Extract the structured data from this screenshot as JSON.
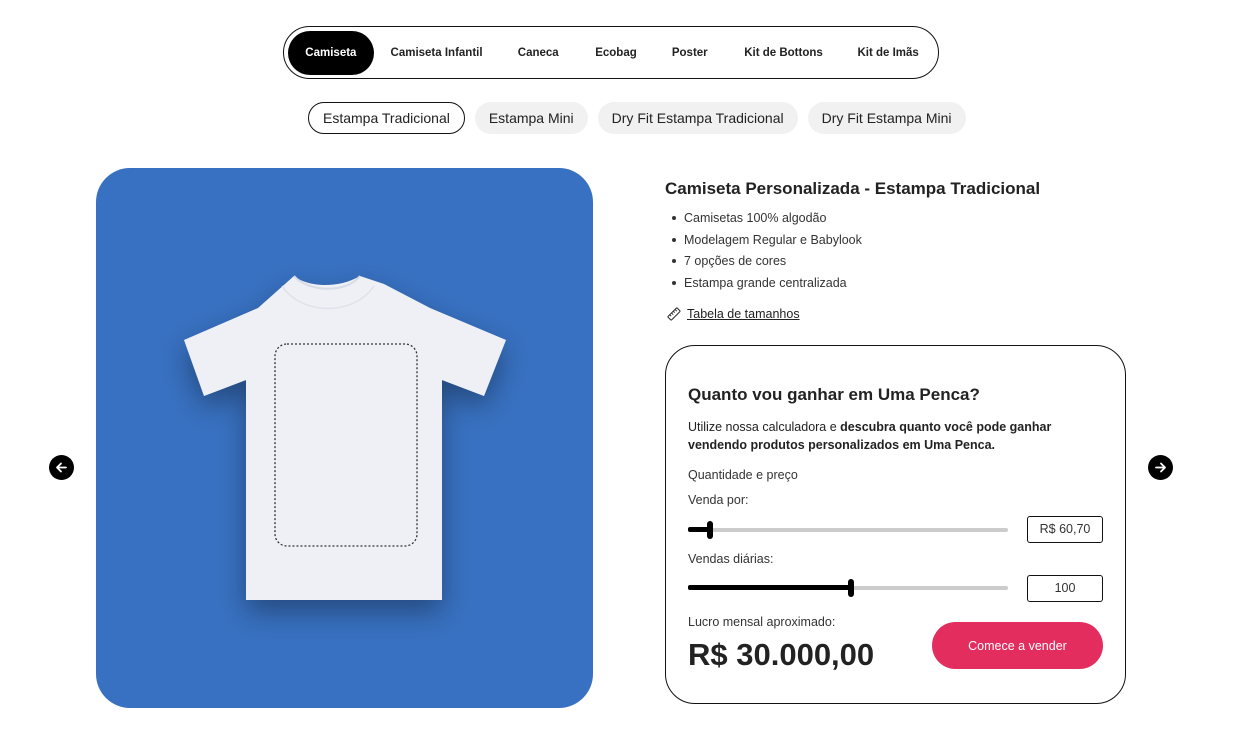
{
  "categories": {
    "items": [
      {
        "label": "Camiseta",
        "active": true
      },
      {
        "label": "Camiseta Infantil",
        "active": false
      },
      {
        "label": "Caneca",
        "active": false
      },
      {
        "label": "Ecobag",
        "active": false
      },
      {
        "label": "Poster",
        "active": false
      },
      {
        "label": "Kit de Bottons",
        "active": false
      },
      {
        "label": "Kit de Imãs",
        "active": false
      }
    ]
  },
  "subcategories": {
    "items": [
      {
        "label": "Estampa Tradicional",
        "active": true
      },
      {
        "label": "Estampa Mini",
        "active": false
      },
      {
        "label": "Dry Fit Estampa Tradicional",
        "active": false
      },
      {
        "label": "Dry Fit Estampa Mini",
        "active": false
      }
    ]
  },
  "product": {
    "title": "Camiseta Personalizada - Estampa Tradicional",
    "features": [
      "Camisetas 100% algodão",
      "Modelagem Regular e Babylook",
      "7 opções de cores",
      "Estampa grande centralizada"
    ],
    "size_chart_link": "Tabela de tamanhos",
    "image_background": "#3871c1"
  },
  "carousel": {
    "prev_icon": "arrow-left-icon",
    "next_icon": "arrow-right-icon"
  },
  "calculator": {
    "title": "Quanto vou ganhar em Uma Penca?",
    "desc_prefix": "Utilize nossa calculadora e ",
    "desc_bold": "descubra quanto você pode ganhar vendendo produtos personalizados em Uma Penca.",
    "section_label": "Quantidade e preço",
    "price_label": "Venda por:",
    "price_value": "R$ 60,70",
    "price_slider_fraction": 0.07,
    "sales_label": "Vendas diárias:",
    "sales_value": "100",
    "sales_slider_fraction": 0.51,
    "profit_label": "Lucro mensal aproximado:",
    "profit_value": "R$ 30.000,00",
    "cta_label": "Comece a vender",
    "cta_color": "#e22d5e"
  }
}
